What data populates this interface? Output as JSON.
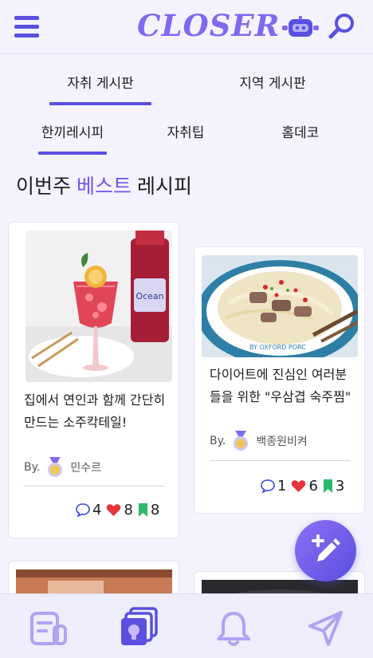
{
  "header": {
    "logo": "CLOSER",
    "icons": [
      "menu-icon",
      "robot-icon",
      "search-icon"
    ]
  },
  "board_tabs": [
    {
      "label": "자취 게시판",
      "active": true
    },
    {
      "label": "지역 게시판",
      "active": false
    }
  ],
  "category_tabs": [
    {
      "label": "한끼레시피",
      "active": true
    },
    {
      "label": "자취팁",
      "active": false
    },
    {
      "label": "홈데코",
      "active": false
    }
  ],
  "section": {
    "prefix": "이번주",
    "accent": "베스트",
    "suffix": "레시피"
  },
  "cards": [
    {
      "title": "집에서 연인과 함께 간단히 만드는 소주칵테일!",
      "by": "By.",
      "author": "민수르",
      "comments": "4",
      "likes": "8",
      "bookmarks": "8"
    },
    {
      "title": "다이어트에 진심인 여러분들을 위한 \"우삼겹 숙주찜\"",
      "by": "By.",
      "author": "백종원비켜",
      "comments": "1",
      "likes": "6",
      "bookmarks": "3"
    }
  ],
  "colors": {
    "accent": "#5a4fe0",
    "accent_light": "#7d6af0",
    "heart": "#e8343a",
    "bookmark": "#2cb96b",
    "background": "#f4f3fd"
  },
  "bottom_nav": [
    "board-icon",
    "recipe-cards-icon",
    "bell-icon",
    "send-icon"
  ]
}
